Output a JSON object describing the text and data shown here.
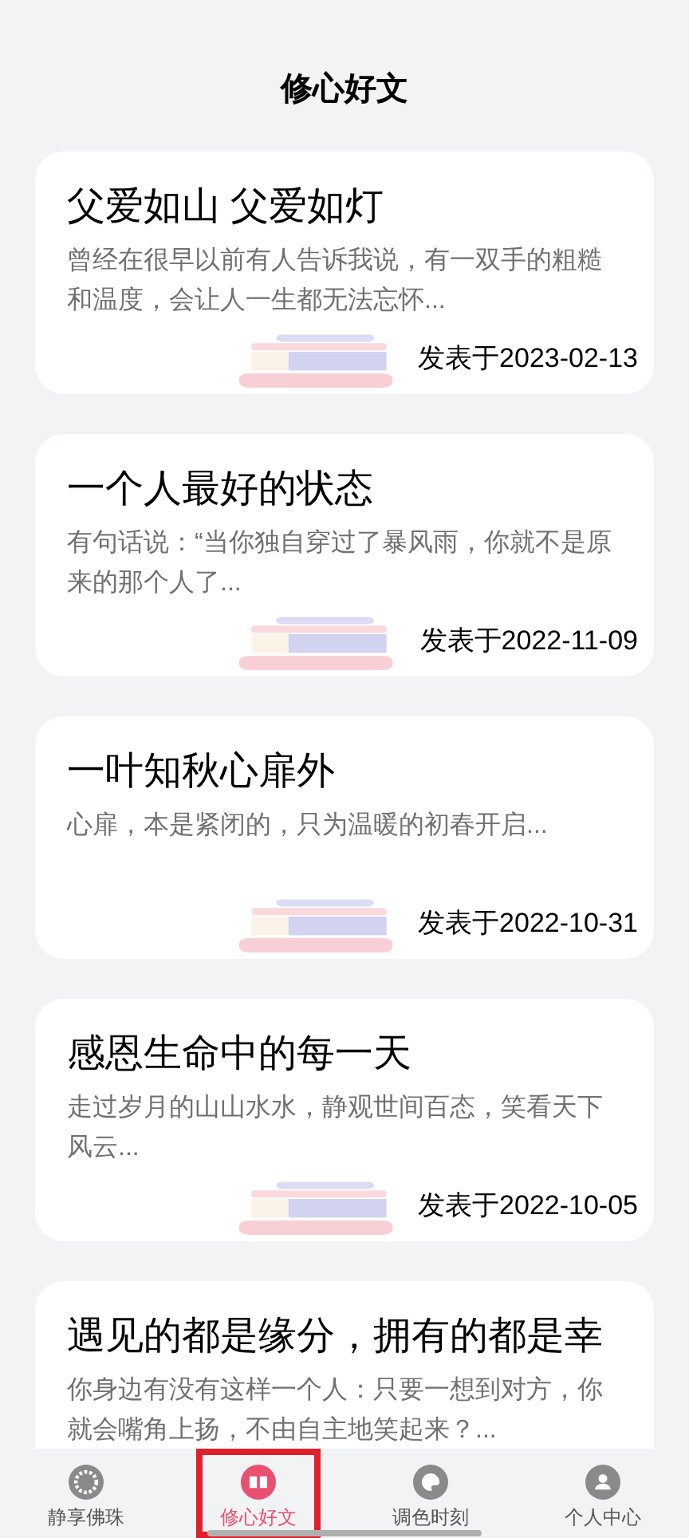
{
  "header": {
    "title": "修心好文"
  },
  "articles": [
    {
      "title": "父爱如山 父爱如灯",
      "excerpt": "曾经在很早以前有人告诉我说，有一双手的粗糙和温度，会让人一生都无法忘怀...",
      "date": "发表于2023-02-13"
    },
    {
      "title": "一个人最好的状态",
      "excerpt": "有句话说：“当你独自穿过了暴风雨，你就不是原来的那个人了...",
      "date": "发表于2022-11-09"
    },
    {
      "title": "一叶知秋心扉外",
      "excerpt": "心扉，本是紧闭的，只为温暖的初春开启...",
      "date": "发表于2022-10-31"
    },
    {
      "title": "感恩生命中的每一天",
      "excerpt": "走过岁月的山山水水，静观世间百态，笑看天下风云...",
      "date": "发表于2022-10-05"
    },
    {
      "title": "遇见的都是缘分，拥有的都是幸",
      "excerpt": "你身边有没有这样一个人：只要一想到对方，你就会嘴角上扬，不由自主地笑起来？..."
    }
  ],
  "tabs": [
    {
      "label": "静享佛珠",
      "kind": "beads",
      "selected": false
    },
    {
      "label": "修心好文",
      "kind": "book",
      "selected": true
    },
    {
      "label": "调色时刻",
      "kind": "palette",
      "selected": false
    },
    {
      "label": "个人中心",
      "kind": "person",
      "selected": false
    }
  ]
}
